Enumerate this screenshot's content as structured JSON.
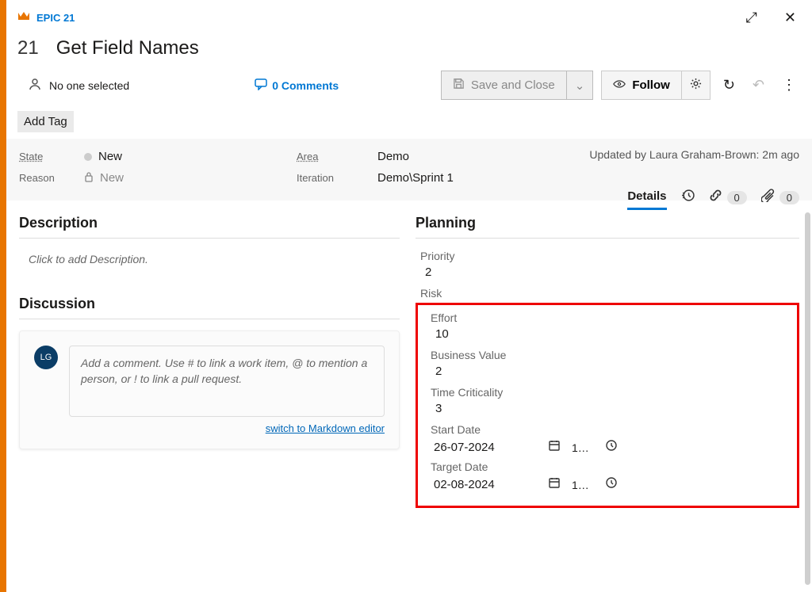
{
  "header": {
    "type_label": "EPIC 21",
    "id": "21",
    "title": "Get Field Names"
  },
  "toolbar": {
    "assignee": "No one selected",
    "comments": "0 Comments",
    "save": "Save and Close",
    "follow": "Follow"
  },
  "addtag": "Add Tag",
  "state": {
    "state_label": "State",
    "state_value": "New",
    "reason_label": "Reason",
    "reason_value": "New",
    "area_label": "Area",
    "area_value": "Demo",
    "iteration_label": "Iteration",
    "iteration_value": "Demo\\Sprint 1",
    "updated": "Updated by Laura Graham-Brown: 2m ago"
  },
  "tabs": {
    "details": "Details",
    "links_count": "0",
    "attach_count": "0"
  },
  "description": {
    "heading": "Description",
    "placeholder": "Click to add Description."
  },
  "discussion": {
    "heading": "Discussion",
    "avatar": "LG",
    "placeholder": "Add a comment. Use # to link a work item, @ to mention a person, or ! to link a pull request.",
    "md_link": "switch to Markdown editor"
  },
  "planning": {
    "heading": "Planning",
    "priority_label": "Priority",
    "priority_value": "2",
    "risk_label": "Risk",
    "effort_label": "Effort",
    "effort_value": "10",
    "bv_label": "Business Value",
    "bv_value": "2",
    "tc_label": "Time Criticality",
    "tc_value": "3",
    "start_label": "Start Date",
    "start_value": "26-07-2024",
    "start_time": "1…",
    "target_label": "Target Date",
    "target_value": "02-08-2024",
    "target_time": "1…"
  }
}
